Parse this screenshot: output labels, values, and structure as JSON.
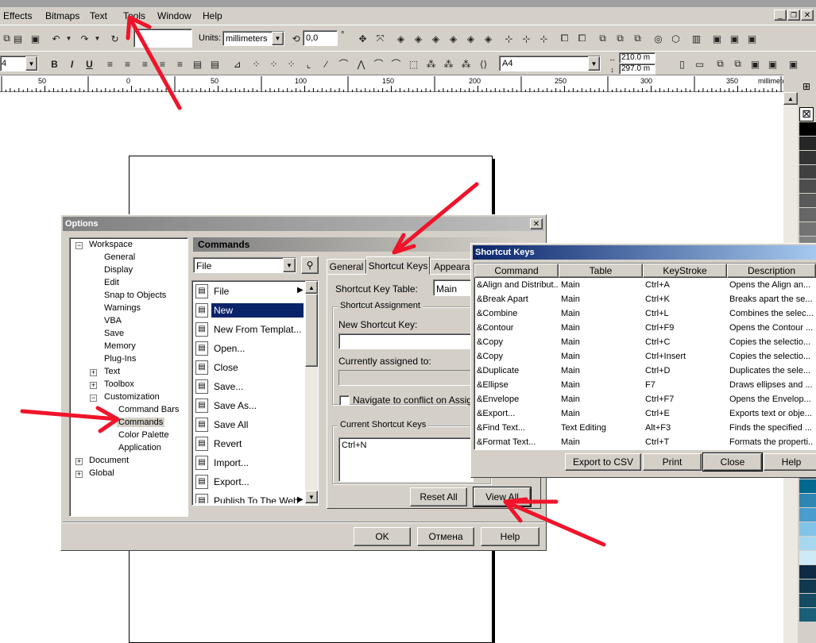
{
  "menubar": {
    "items": [
      "Effects",
      "Bitmaps",
      "Text",
      "Tools",
      "Window",
      "Help"
    ]
  },
  "toolbar1": {
    "units_label": "Units:",
    "units_value": "millimeters",
    "angle_value": "0,0",
    "angle_unit": "°"
  },
  "toolbar2": {
    "font_size": "4",
    "page_size": "A4",
    "width": "210.0 m",
    "height": "297.0 m"
  },
  "ruler": {
    "marks": [
      "50",
      "0",
      "50",
      "100",
      "150",
      "200",
      "250",
      "300",
      "350"
    ],
    "unit": "millimeters"
  },
  "options_dialog": {
    "title": "Options",
    "tree": [
      {
        "label": "Workspace",
        "level": 0,
        "expander": "-"
      },
      {
        "label": "General",
        "level": 1
      },
      {
        "label": "Display",
        "level": 1
      },
      {
        "label": "Edit",
        "level": 1
      },
      {
        "label": "Snap to Objects",
        "level": 1
      },
      {
        "label": "Warnings",
        "level": 1
      },
      {
        "label": "VBA",
        "level": 1
      },
      {
        "label": "Save",
        "level": 1
      },
      {
        "label": "Memory",
        "level": 1
      },
      {
        "label": "Plug-Ins",
        "level": 1
      },
      {
        "label": "Text",
        "level": 1,
        "expander": "+"
      },
      {
        "label": "Toolbox",
        "level": 1,
        "expander": "+"
      },
      {
        "label": "Customization",
        "level": 1,
        "expander": "-"
      },
      {
        "label": "Command Bars",
        "level": 2
      },
      {
        "label": "Commands",
        "level": 2,
        "selected": true
      },
      {
        "label": "Color Palette",
        "level": 2
      },
      {
        "label": "Application",
        "level": 2
      },
      {
        "label": "Document",
        "level": 0,
        "expander": "+"
      },
      {
        "label": "Global",
        "level": 0,
        "expander": "+"
      }
    ],
    "panel_title": "Commands",
    "category_value": "File",
    "commands": [
      {
        "label": "File",
        "icon": "file-icon",
        "submenu": true
      },
      {
        "label": "New",
        "icon": "new-icon",
        "selected": true
      },
      {
        "label": "New From Templat...",
        "icon": "template-icon"
      },
      {
        "label": "Open...",
        "icon": "open-icon"
      },
      {
        "label": "Close",
        "icon": "close-doc-icon"
      },
      {
        "label": "Save...",
        "icon": "save-icon"
      },
      {
        "label": "Save As...",
        "icon": "save-as-icon"
      },
      {
        "label": "Save All",
        "icon": "save-all-icon"
      },
      {
        "label": "Revert",
        "icon": "revert-icon"
      },
      {
        "label": "Import...",
        "icon": "import-icon"
      },
      {
        "label": "Export...",
        "icon": "export-icon"
      },
      {
        "label": "Publish To The Web",
        "icon": "publish-icon",
        "submenu": true
      }
    ],
    "tabs": [
      "General",
      "Shortcut Keys",
      "Appearan"
    ],
    "shortcut_table_label": "Shortcut Key Table:",
    "shortcut_table_value": "Main",
    "assignment_group": "Shortcut Assignment",
    "new_key_label": "New Shortcut Key:",
    "assigned_label": "Currently assigned to:",
    "navigate_label": "Navigate to conflict on Assign",
    "current_group": "Current Shortcut Keys",
    "current_keys": "Ctrl+N",
    "reset_all": "Reset All",
    "view_all": "View All",
    "ok": "OK",
    "cancel": "Отмена",
    "help": "Help",
    "close_x": "✕"
  },
  "shortcut_dialog": {
    "title": "Shortcut Keys",
    "columns": [
      "Command",
      "Table",
      "KeyStroke",
      "Description"
    ],
    "rows": [
      [
        "&Align and Distribut...",
        "Main",
        "Ctrl+A",
        "Opens the Align an..."
      ],
      [
        "&Break  Apart",
        "Main",
        "Ctrl+K",
        "Breaks apart the se..."
      ],
      [
        "&Combine",
        "Main",
        "Ctrl+L",
        "Combines the selec..."
      ],
      [
        "&Contour",
        "Main",
        "Ctrl+F9",
        "Opens the Contour ..."
      ],
      [
        "&Copy",
        "Main",
        "Ctrl+C",
        "Copies the selectio..."
      ],
      [
        "&Copy",
        "Main",
        "Ctrl+Insert",
        "Copies the selectio..."
      ],
      [
        "&Duplicate",
        "Main",
        "Ctrl+D",
        "Duplicates the sele..."
      ],
      [
        "&Ellipse",
        "Main",
        "F7",
        "Draws ellipses and ..."
      ],
      [
        "&Envelope",
        "Main",
        "Ctrl+F7",
        "Opens the Envelop..."
      ],
      [
        "&Export...",
        "Main",
        "Ctrl+E",
        "Exports text or obje..."
      ],
      [
        "&Find Text...",
        "Text Editing",
        "Alt+F3",
        "Finds the specified ..."
      ],
      [
        "&Format Text...",
        "Main",
        "Ctrl+T",
        "Formats the properti..."
      ]
    ],
    "buttons": [
      "Export to CSV",
      "Print",
      "Close",
      "Help"
    ]
  },
  "colors": {
    "dialog_bg": "#d4d0c8",
    "title_dark": "#808080",
    "selection": "#0a246a",
    "annotation_arrow": "#f0142a"
  }
}
